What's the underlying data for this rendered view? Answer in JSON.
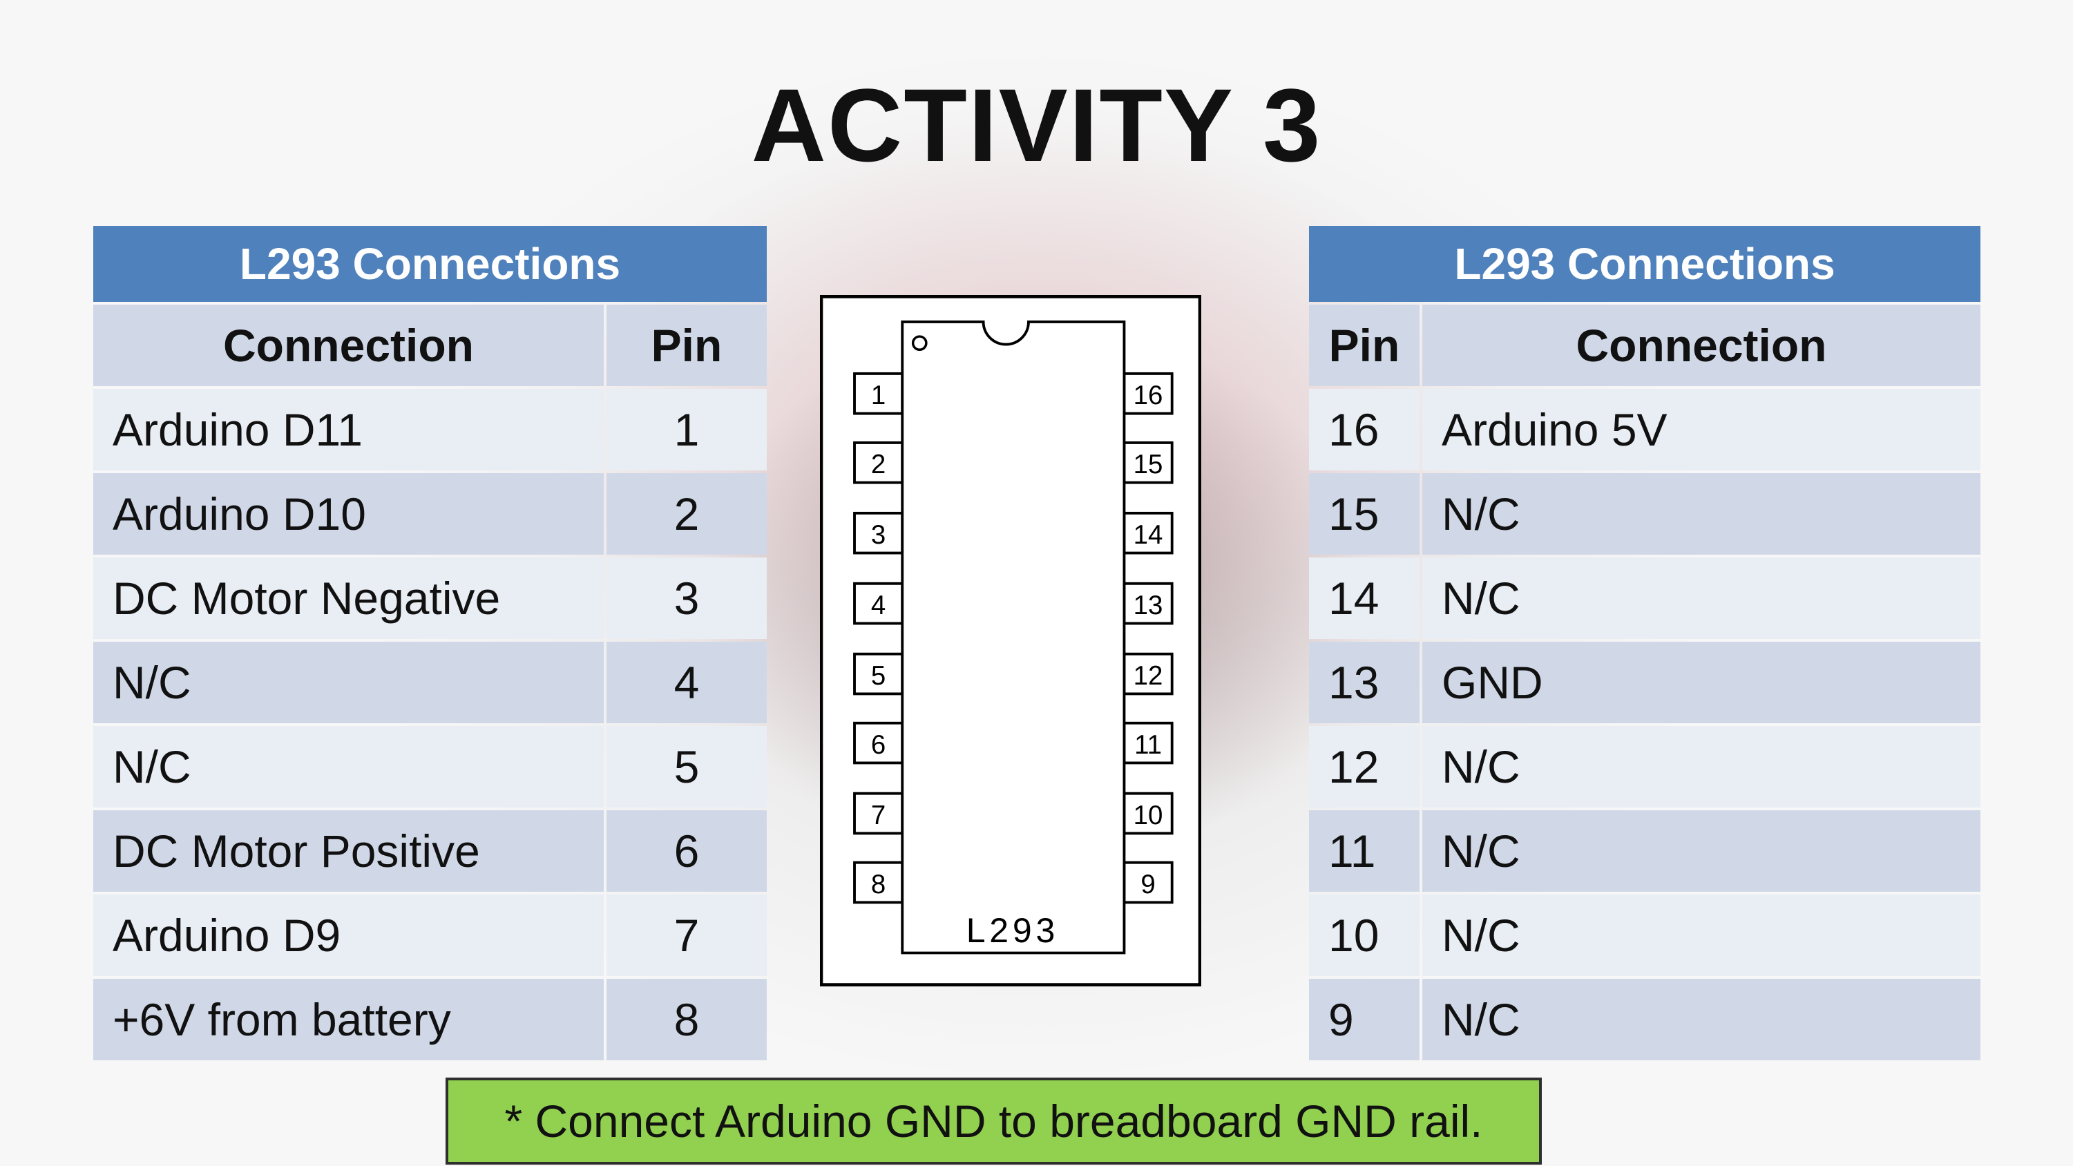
{
  "title": "ACTIVITY 3",
  "colors": {
    "header": "#4F81BD",
    "row_dark": "#D0D8E8",
    "row_light": "#E9EDF4",
    "note_bg": "#92D050"
  },
  "left_table": {
    "title": "L293 Connections",
    "columns": [
      "Connection",
      "Pin"
    ],
    "rows": [
      {
        "connection": "Arduino D11",
        "pin": "1"
      },
      {
        "connection": "Arduino D10",
        "pin": "2"
      },
      {
        "connection": "DC Motor Negative",
        "pin": "3"
      },
      {
        "connection": "N/C",
        "pin": "4"
      },
      {
        "connection": "N/C",
        "pin": "5"
      },
      {
        "connection": "DC Motor Positive",
        "pin": "6"
      },
      {
        "connection": "Arduino D9",
        "pin": "7"
      },
      {
        "connection": "+6V from battery",
        "pin": "8"
      }
    ]
  },
  "right_table": {
    "title": "L293 Connections",
    "columns": [
      "Pin",
      "Connection"
    ],
    "rows": [
      {
        "pin": "16",
        "connection": "Arduino 5V"
      },
      {
        "pin": "15",
        "connection": "N/C"
      },
      {
        "pin": "14",
        "connection": "N/C"
      },
      {
        "pin": "13",
        "connection": "GND"
      },
      {
        "pin": "12",
        "connection": "N/C"
      },
      {
        "pin": "11",
        "connection": "N/C"
      },
      {
        "pin": "10",
        "connection": "N/C"
      },
      {
        "pin": "9",
        "connection": "N/C"
      }
    ]
  },
  "chip": {
    "label": "L293",
    "left_pins": [
      "1",
      "2",
      "3",
      "4",
      "5",
      "6",
      "7",
      "8"
    ],
    "right_pins": [
      "16",
      "15",
      "14",
      "13",
      "12",
      "11",
      "10",
      "9"
    ]
  },
  "note": "* Connect Arduino GND to breadboard GND rail."
}
